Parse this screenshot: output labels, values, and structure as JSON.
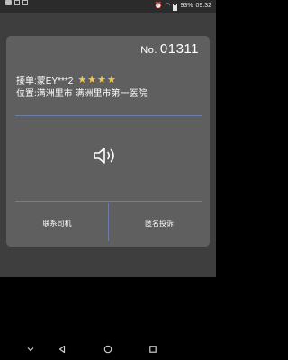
{
  "status_bar": {
    "battery": "93%",
    "time": "09:32",
    "icons": [
      "sim-icon",
      "photo-icon",
      "app-icon",
      "alarm-icon",
      "wifi-icon",
      "battery-icon"
    ]
  },
  "dialog": {
    "order_prefix": "No.",
    "order_number": "01311",
    "order_label": "接单:蒙EY***2",
    "rating": 4,
    "stars": "★★★★",
    "location": "位置:满洲里市 满洲里市第一医院",
    "speaker_icon": "speaker-icon",
    "buttons": {
      "contact_driver": "联系司机",
      "anonymous_complaint": "匿名投诉"
    }
  },
  "nav_bar": {
    "icons": [
      "chevron-down-icon",
      "back-icon",
      "home-icon",
      "recents-icon"
    ]
  }
}
